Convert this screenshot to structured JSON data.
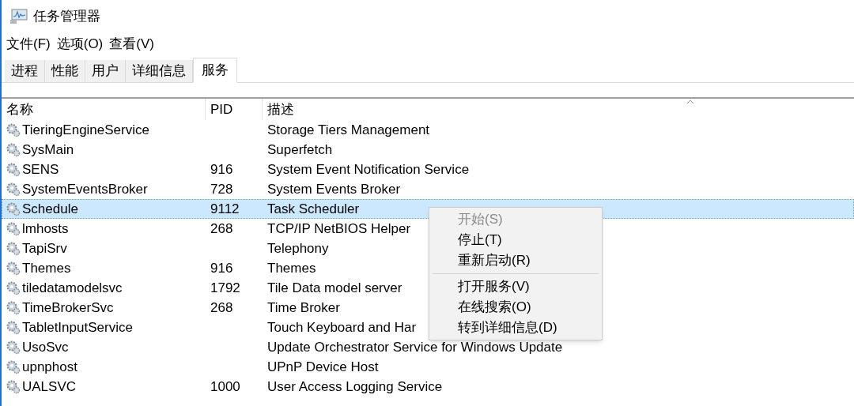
{
  "window": {
    "title": "任务管理器"
  },
  "menu_bar": [
    "文件(F)",
    "选项(O)",
    "查看(V)"
  ],
  "tabs": [
    {
      "label": "进程",
      "selected": false
    },
    {
      "label": "性能",
      "selected": false
    },
    {
      "label": "用户",
      "selected": false
    },
    {
      "label": "详细信息",
      "selected": false
    },
    {
      "label": "服务",
      "selected": true
    }
  ],
  "table": {
    "columns": [
      "名称",
      "PID",
      "描述"
    ],
    "rows": [
      {
        "name": "TieringEngineService",
        "pid": "",
        "description": "Storage Tiers Management",
        "selected": false
      },
      {
        "name": "SysMain",
        "pid": "",
        "description": "Superfetch",
        "selected": false
      },
      {
        "name": "SENS",
        "pid": "916",
        "description": "System Event Notification Service",
        "selected": false
      },
      {
        "name": "SystemEventsBroker",
        "pid": "728",
        "description": "System Events Broker",
        "selected": false
      },
      {
        "name": "Schedule",
        "pid": "9112",
        "description": "Task Scheduler",
        "selected": true
      },
      {
        "name": "lmhosts",
        "pid": "268",
        "description": "TCP/IP NetBIOS Helper",
        "selected": false
      },
      {
        "name": "TapiSrv",
        "pid": "",
        "description": "Telephony",
        "selected": false
      },
      {
        "name": "Themes",
        "pid": "916",
        "description": "Themes",
        "selected": false
      },
      {
        "name": "tiledatamodelsvc",
        "pid": "1792",
        "description": "Tile Data model server",
        "selected": false
      },
      {
        "name": "TimeBrokerSvc",
        "pid": "268",
        "description": "Time Broker",
        "selected": false
      },
      {
        "name": "TabletInputService",
        "pid": "",
        "description": "Touch Keyboard and Har",
        "selected": false
      },
      {
        "name": "UsoSvc",
        "pid": "",
        "description": "Update Orchestrator Service for Windows Update",
        "selected": false
      },
      {
        "name": "upnphost",
        "pid": "",
        "description": "UPnP Device Host",
        "selected": false
      },
      {
        "name": "UALSVC",
        "pid": "1000",
        "description": "User Access Logging Service",
        "selected": false
      }
    ]
  },
  "context_menu": {
    "items": [
      {
        "kind": "item",
        "label": "开始(S)",
        "disabled": true
      },
      {
        "kind": "item",
        "label": "停止(T)",
        "disabled": false
      },
      {
        "kind": "item",
        "label": "重新启动(R)",
        "disabled": false
      },
      {
        "kind": "separator"
      },
      {
        "kind": "item",
        "label": "打开服务(V)",
        "disabled": false
      },
      {
        "kind": "item",
        "label": "在线搜索(O)",
        "disabled": false
      },
      {
        "kind": "item",
        "label": "转到详细信息(D)",
        "disabled": false
      }
    ]
  }
}
